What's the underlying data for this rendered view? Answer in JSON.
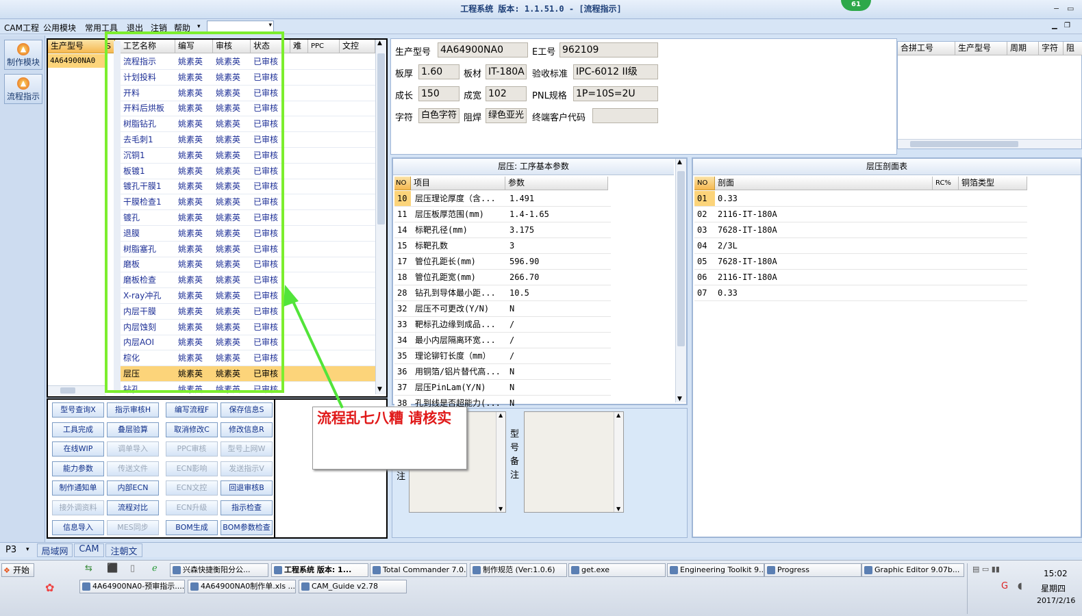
{
  "window": {
    "title": "工程系统  版本: 1.1.51.0 - [流程指示]",
    "badge": "61",
    "min": "−",
    "max": "▭"
  },
  "menu": [
    "CAM工程",
    "公用模块",
    "常用工具",
    "退出",
    "注销",
    "帮助"
  ],
  "left_modules": [
    {
      "label": "制作模块"
    },
    {
      "label": "流程指示"
    }
  ],
  "model_list": {
    "header": "生产型号",
    "header2": "S板",
    "items": [
      "4A64900NA0"
    ]
  },
  "process_table": {
    "headers": [
      "工艺名称",
      "编写",
      "审核",
      "状态",
      "难",
      "PPC",
      "文控"
    ],
    "rows": [
      [
        "流程指示",
        "姚素英",
        "姚素英",
        "已审核"
      ],
      [
        "计划投料",
        "姚素英",
        "姚素英",
        "已审核"
      ],
      [
        "开料",
        "姚素英",
        "姚素英",
        "已审核"
      ],
      [
        "开料后烘板",
        "姚素英",
        "姚素英",
        "已审核"
      ],
      [
        "树脂钻孔",
        "姚素英",
        "姚素英",
        "已审核"
      ],
      [
        "去毛刺1",
        "姚素英",
        "姚素英",
        "已审核"
      ],
      [
        "沉铜1",
        "姚素英",
        "姚素英",
        "已审核"
      ],
      [
        "板镀1",
        "姚素英",
        "姚素英",
        "已审核"
      ],
      [
        "镀孔干膜1",
        "姚素英",
        "姚素英",
        "已审核"
      ],
      [
        "干膜检查1",
        "姚素英",
        "姚素英",
        "已审核"
      ],
      [
        "镀孔",
        "姚素英",
        "姚素英",
        "已审核"
      ],
      [
        "退膜",
        "姚素英",
        "姚素英",
        "已审核"
      ],
      [
        "树脂塞孔",
        "姚素英",
        "姚素英",
        "已审核"
      ],
      [
        "磨板",
        "姚素英",
        "姚素英",
        "已审核"
      ],
      [
        "磨板检查",
        "姚素英",
        "姚素英",
        "已审核"
      ],
      [
        "X-ray冲孔",
        "姚素英",
        "姚素英",
        "已审核"
      ],
      [
        "内层干膜",
        "姚素英",
        "姚素英",
        "已审核"
      ],
      [
        "内层蚀刻",
        "姚素英",
        "姚素英",
        "已审核"
      ],
      [
        "内层AOI",
        "姚素英",
        "姚素英",
        "已审核"
      ],
      [
        "棕化",
        "姚素英",
        "姚素英",
        "已审核"
      ],
      [
        "层压",
        "姚素英",
        "姚素英",
        "已审核"
      ],
      [
        "钻孔",
        "姚素英",
        "姚素英",
        "已审核"
      ]
    ],
    "selected_index": 20
  },
  "buttons": [
    [
      {
        "t": "型号查询X",
        "d": false
      },
      {
        "t": "指示审核H",
        "d": false
      },
      {
        "t": "编写流程F",
        "d": false
      },
      {
        "t": "保存信息S",
        "d": false
      }
    ],
    [
      {
        "t": "工具完成",
        "d": false
      },
      {
        "t": "叠层验算",
        "d": false
      },
      {
        "t": "取消修改C",
        "d": false
      },
      {
        "t": "修改信息R",
        "d": false
      }
    ],
    [
      {
        "t": "在线WIP",
        "d": false
      },
      {
        "t": "调单导入",
        "d": true
      },
      {
        "t": "PPC审核",
        "d": true
      },
      {
        "t": "型号上网W",
        "d": true
      }
    ],
    [
      {
        "t": "能力参数",
        "d": false
      },
      {
        "t": "传送文件",
        "d": true
      },
      {
        "t": "ECN影响",
        "d": true
      },
      {
        "t": "发送指示V",
        "d": true
      }
    ],
    [
      {
        "t": "制作通知单",
        "d": false
      },
      {
        "t": "内部ECN",
        "d": false
      },
      {
        "t": "ECN文控",
        "d": true
      },
      {
        "t": "回退审核B",
        "d": false
      }
    ],
    [
      {
        "t": "接外调资料",
        "d": true
      },
      {
        "t": "流程对比",
        "d": false
      },
      {
        "t": "ECN升级",
        "d": true
      },
      {
        "t": "指示检查",
        "d": false
      }
    ],
    [
      {
        "t": "信息导入",
        "d": false
      },
      {
        "t": "MES同步",
        "d": true
      },
      {
        "t": "BOM生成",
        "d": false
      },
      {
        "t": "BOM参数检查",
        "d": false
      }
    ]
  ],
  "info": {
    "model_label": "生产型号",
    "model": "4A64900NA0",
    "e_label": "E工号",
    "e": "962109",
    "thick_label": "板厚",
    "thick": "1.60",
    "mat_label": "板材",
    "mat": "IT-180A",
    "std_label": "验收标准",
    "std": "IPC-6012 II级",
    "len_label": "成长",
    "len": "150",
    "wid_label": "成宽",
    "wid": "102",
    "pnl_label": "PNL规格",
    "pnl": "1P=10S=2U",
    "char_label": "字符",
    "char": "白色字符",
    "mask_label": "阻焊",
    "mask": "绿色亚光",
    "cust_label": "终端客户代码",
    "cust": ""
  },
  "right_grid": {
    "headers": [
      "合拼工号",
      "生产型号",
      "周期",
      "字符",
      "阻"
    ]
  },
  "lam_params": {
    "title": "层压: 工序基本参数",
    "headers": [
      "NO",
      "项目",
      "参数"
    ],
    "rows": [
      [
        "10",
        "层压理论厚度（含...",
        "1.491"
      ],
      [
        "11",
        "层压板厚范围(mm)",
        "1.4-1.65"
      ],
      [
        "14",
        "标靶孔径(mm)",
        "3.175"
      ],
      [
        "15",
        "标靶孔数",
        "3"
      ],
      [
        "17",
        "管位孔距长(mm)",
        "596.90"
      ],
      [
        "18",
        "管位孔距宽(mm)",
        "266.70"
      ],
      [
        "28",
        "钻孔到导体最小距...",
        "10.5"
      ],
      [
        "32",
        "层压不可更改(Y/N)",
        "N"
      ],
      [
        "33",
        "靶标孔边缘到成品...",
        "/"
      ],
      [
        "34",
        "最小内层隔离环宽...",
        "/"
      ],
      [
        "35",
        "理论铆钉长度（mm）",
        "/"
      ],
      [
        "36",
        "用铜箔/铝片替代高...",
        "N"
      ],
      [
        "37",
        "层压PinLam(Y/N)",
        "N"
      ],
      [
        "38",
        "孔到线是否超能力(...",
        "N"
      ]
    ]
  },
  "stackup": {
    "title": "层压剖面表",
    "headers": [
      "NO",
      "剖面",
      "RC%",
      "铜箔类型"
    ],
    "rows": [
      [
        "01",
        "0.33"
      ],
      [
        "02",
        "2116-IT-180A"
      ],
      [
        "03",
        "7628-IT-180A"
      ],
      [
        "04",
        "2/3L"
      ],
      [
        "05",
        "7628-IT-180A"
      ],
      [
        "06",
        "2116-IT-180A"
      ],
      [
        "07",
        "0.33"
      ]
    ]
  },
  "remarks": {
    "left_label": "注",
    "right_label": "型号备注"
  },
  "callout": "流程乱七八糟   请核实",
  "status": {
    "p": "P3",
    "tabs": [
      "局域网",
      "CAM",
      "注朝文"
    ]
  },
  "taskbar": {
    "start": "开始",
    "row1": [
      "兴森快捷衡阳分公...",
      "工程系统  版本: 1...",
      "Total Commander 7.0...",
      "制作规范 (Ver:1.0.6)",
      "get.exe",
      "Engineering Toolkit 9....",
      "Progress",
      "Graphic Editor 9.07b..."
    ],
    "row2": [
      "4A64900NA0-预审指示....",
      "4A64900NA0制作单.xls ...",
      "CAM_Guide v2.78"
    ],
    "time": "15:02",
    "weekday": "星期四",
    "date": "2017/2/16"
  }
}
